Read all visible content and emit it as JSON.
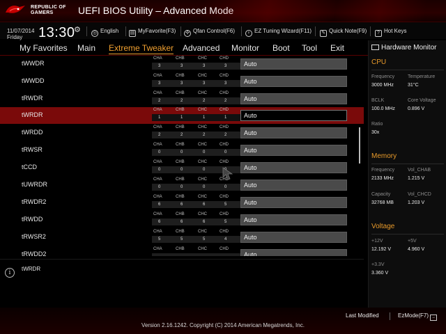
{
  "header": {
    "brand_line1": "REPUBLIC OF",
    "brand_line2": "GAMERS",
    "title": "UEFI BIOS Utility – Advanced Mode"
  },
  "infobar": {
    "date": "11/07/2014",
    "day": "Friday",
    "time": "13:30",
    "tools": [
      {
        "label": "English",
        "icon": "globe-icon"
      },
      {
        "label": "MyFavorite(F3)",
        "icon": "favorite-icon"
      },
      {
        "label": "Qfan Control(F6)",
        "icon": "fan-icon"
      },
      {
        "label": "EZ Tuning Wizard(F11)",
        "icon": "bulb-icon"
      },
      {
        "label": "Quick Note(F9)",
        "icon": "note-icon"
      },
      {
        "label": "Hot Keys",
        "icon": "help-icon"
      }
    ]
  },
  "tabs": [
    {
      "label": "My Favorites"
    },
    {
      "label": "Main"
    },
    {
      "label": "Extreme Tweaker",
      "active": true
    },
    {
      "label": "Advanced"
    },
    {
      "label": "Monitor"
    },
    {
      "label": "Boot"
    },
    {
      "label": "Tool"
    },
    {
      "label": "Exit"
    }
  ],
  "channel_names": [
    "CHA",
    "CHB",
    "CHC",
    "CHD"
  ],
  "rows": [
    {
      "label": "tWWDR",
      "values": [
        "3",
        "3",
        "3",
        "3"
      ],
      "setting": "Auto"
    },
    {
      "label": "tWWDD",
      "values": [
        "3",
        "3",
        "3",
        "3"
      ],
      "setting": "Auto"
    },
    {
      "label": "tRWDR",
      "values": [
        "2",
        "2",
        "2",
        "2"
      ],
      "setting": "Auto"
    },
    {
      "label": "tWRDR",
      "values": [
        "1",
        "1",
        "1",
        "1"
      ],
      "setting": "Auto",
      "selected": true
    },
    {
      "label": "tWRDD",
      "values": [
        "2",
        "2",
        "2",
        "2"
      ],
      "setting": "Auto"
    },
    {
      "label": "tRWSR",
      "values": [
        "0",
        "0",
        "0",
        "0"
      ],
      "setting": "Auto"
    },
    {
      "label": "tCCD",
      "values": [
        "0",
        "0",
        "0",
        "0"
      ],
      "setting": "Auto"
    },
    {
      "label": "tUWRDR",
      "values": [
        "0",
        "0",
        "0",
        "0"
      ],
      "setting": "Auto"
    },
    {
      "label": "tRWDR2",
      "values": [
        "6",
        "6",
        "6",
        "5"
      ],
      "setting": "Auto"
    },
    {
      "label": "tRWDD",
      "values": [
        "6",
        "6",
        "6",
        "5"
      ],
      "setting": "Auto"
    },
    {
      "label": "tRWSR2",
      "values": [
        "5",
        "5",
        "5",
        "4"
      ],
      "setting": "Auto"
    },
    {
      "label": "tRWDD2",
      "values": [
        "",
        "",
        "",
        ""
      ],
      "setting": "Auto"
    }
  ],
  "help": {
    "text": "tWRDR"
  },
  "hardware_monitor": {
    "title": "Hardware Monitor",
    "cpu": {
      "heading": "CPU",
      "frequency_label": "Frequency",
      "frequency": "3000 MHz",
      "temperature_label": "Temperature",
      "temperature": "31°C",
      "bclk_label": "BCLK",
      "bclk": "100.0 MHz",
      "core_voltage_label": "Core Voltage",
      "core_voltage": "0.896 V",
      "ratio_label": "Ratio",
      "ratio": "30x"
    },
    "memory": {
      "heading": "Memory",
      "frequency_label": "Frequency",
      "frequency": "2133 MHz",
      "vol_chab_label": "Vol_CHAB",
      "vol_chab": "1.215 V",
      "capacity_label": "Capacity",
      "capacity": "32768 MB",
      "vol_chcd_label": "Vol_CHCD",
      "vol_chcd": "1.203 V"
    },
    "voltage": {
      "heading": "Voltage",
      "v12_label": "+12V",
      "v12": "12.192 V",
      "v5_label": "+5V",
      "v5": "4.960 V",
      "v33_label": "+3.3V",
      "v33": "3.360 V"
    }
  },
  "footer": {
    "last_modified": "Last Modified",
    "ezmode": "EzMode(F7)",
    "version": "Version 2.16.1242. Copyright (C) 2014 American Megatrends, Inc."
  },
  "colors": {
    "accent": "#f0a030",
    "selected_row": "#7a0a0a",
    "header": "#2a0000"
  }
}
